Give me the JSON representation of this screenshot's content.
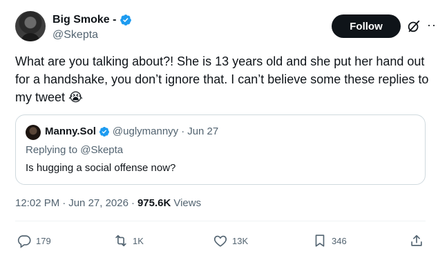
{
  "author": {
    "display_name": "Big Smoke -",
    "handle": "@Skepta"
  },
  "header": {
    "follow_label": "Follow",
    "more_label": "···"
  },
  "tweet": {
    "text": "What are you talking about?! She is 13 years old and she put her hand out for a handshake, you don’t ignore that. I can’t believe some these replies to my tweet 😭"
  },
  "quote": {
    "display_name": "Manny.Sol",
    "handle": "@uglymannyy",
    "separator": "·",
    "date": "Jun 27",
    "replying_prefix": "Replying to",
    "replying_mention": "@Skepta",
    "text": "Is hugging a social offense now?"
  },
  "meta": {
    "time": "12:02 PM",
    "separator1": "·",
    "date": "Jun 27, 2026",
    "separator2": "·",
    "views_count": "975.6K",
    "views_label": "Views"
  },
  "actions": {
    "replies": "179",
    "reposts": "1K",
    "likes": "13K",
    "bookmarks": "346"
  },
  "colors": {
    "text_primary": "#0f1419",
    "text_secondary": "#536471",
    "verified_blue": "#1d9bf0",
    "border": "#cfd9de"
  },
  "icons": {
    "verified": "verified-badge-icon",
    "grok": "grok-icon",
    "more": "more-icon",
    "reply": "reply-icon",
    "retweet": "retweet-icon",
    "like": "heart-icon",
    "bookmark": "bookmark-icon",
    "share": "share-icon"
  }
}
